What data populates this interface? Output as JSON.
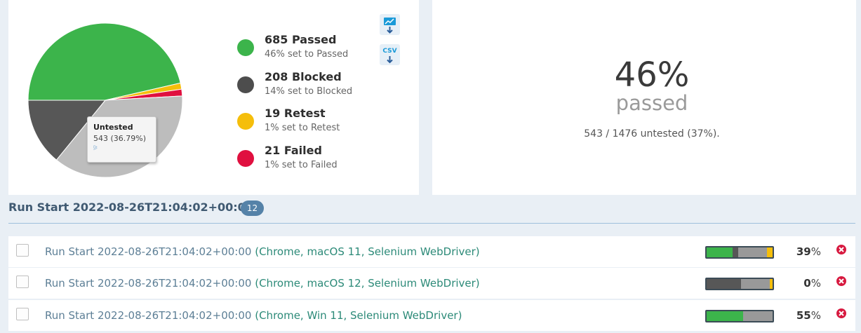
{
  "chart_data": {
    "type": "pie",
    "slices": [
      {
        "label": "Passed",
        "value": 685,
        "color": "#3cb44b"
      },
      {
        "label": "Retest",
        "value": 19,
        "color": "#f5be0b"
      },
      {
        "label": "Failed",
        "value": 21,
        "color": "#e0103f"
      },
      {
        "label": "Untested",
        "value": 543,
        "color": "#bdbdbd"
      },
      {
        "label": "Blocked",
        "value": 208,
        "color": "#575757"
      }
    ],
    "tooltip": {
      "title": "Untested",
      "value": "543 (36.79%)"
    }
  },
  "legend": [
    {
      "title": "685 Passed",
      "sub": "46% set to Passed",
      "color": "#3cb44b"
    },
    {
      "title": "208 Blocked",
      "sub": "14% set to Blocked",
      "color": "#4d4d4d"
    },
    {
      "title": "19 Retest",
      "sub": "1% set to Retest",
      "color": "#f5be0b"
    },
    {
      "title": "21 Failed",
      "sub": "1% set to Failed",
      "color": "#e0103f"
    }
  ],
  "export": {
    "csv_label": "CSV",
    "image_icon": "chart-image-download-icon",
    "csv_icon": "csv-download-icon"
  },
  "stats": {
    "percent": "46%",
    "word": "passed",
    "untested": "543 / 1476 untested (37%)."
  },
  "group": {
    "title": "Run Start 2022-08-26T21:04:02+00:00",
    "count": "12"
  },
  "runs": [
    {
      "name": "Run Start 2022-08-26T21:04:02+00:00",
      "config": "(Chrome, macOS 11, Selenium WebDriver)",
      "percent": "39",
      "progress": {
        "passed": 0.39,
        "blocked": 0.09,
        "untested": 0.43,
        "retest": 0.09
      }
    },
    {
      "name": "Run Start 2022-08-26T21:04:02+00:00",
      "config": "(Chrome, macOS 12, Selenium WebDriver)",
      "percent": "0",
      "progress": {
        "passed": 0,
        "blocked": 0.52,
        "untested": 0.44,
        "retest": 0.04
      }
    },
    {
      "name": "Run Start 2022-08-26T21:04:02+00:00",
      "config": "(Chrome, Win 11, Selenium WebDriver)",
      "percent": "55",
      "progress": {
        "passed": 0.55,
        "blocked": 0,
        "untested": 0.45,
        "retest": 0
      }
    }
  ],
  "colors": {
    "passed": "#3cb44b",
    "blocked": "#575757",
    "untested": "#999999",
    "retest": "#f5be0b",
    "delete": "#d7193f"
  }
}
